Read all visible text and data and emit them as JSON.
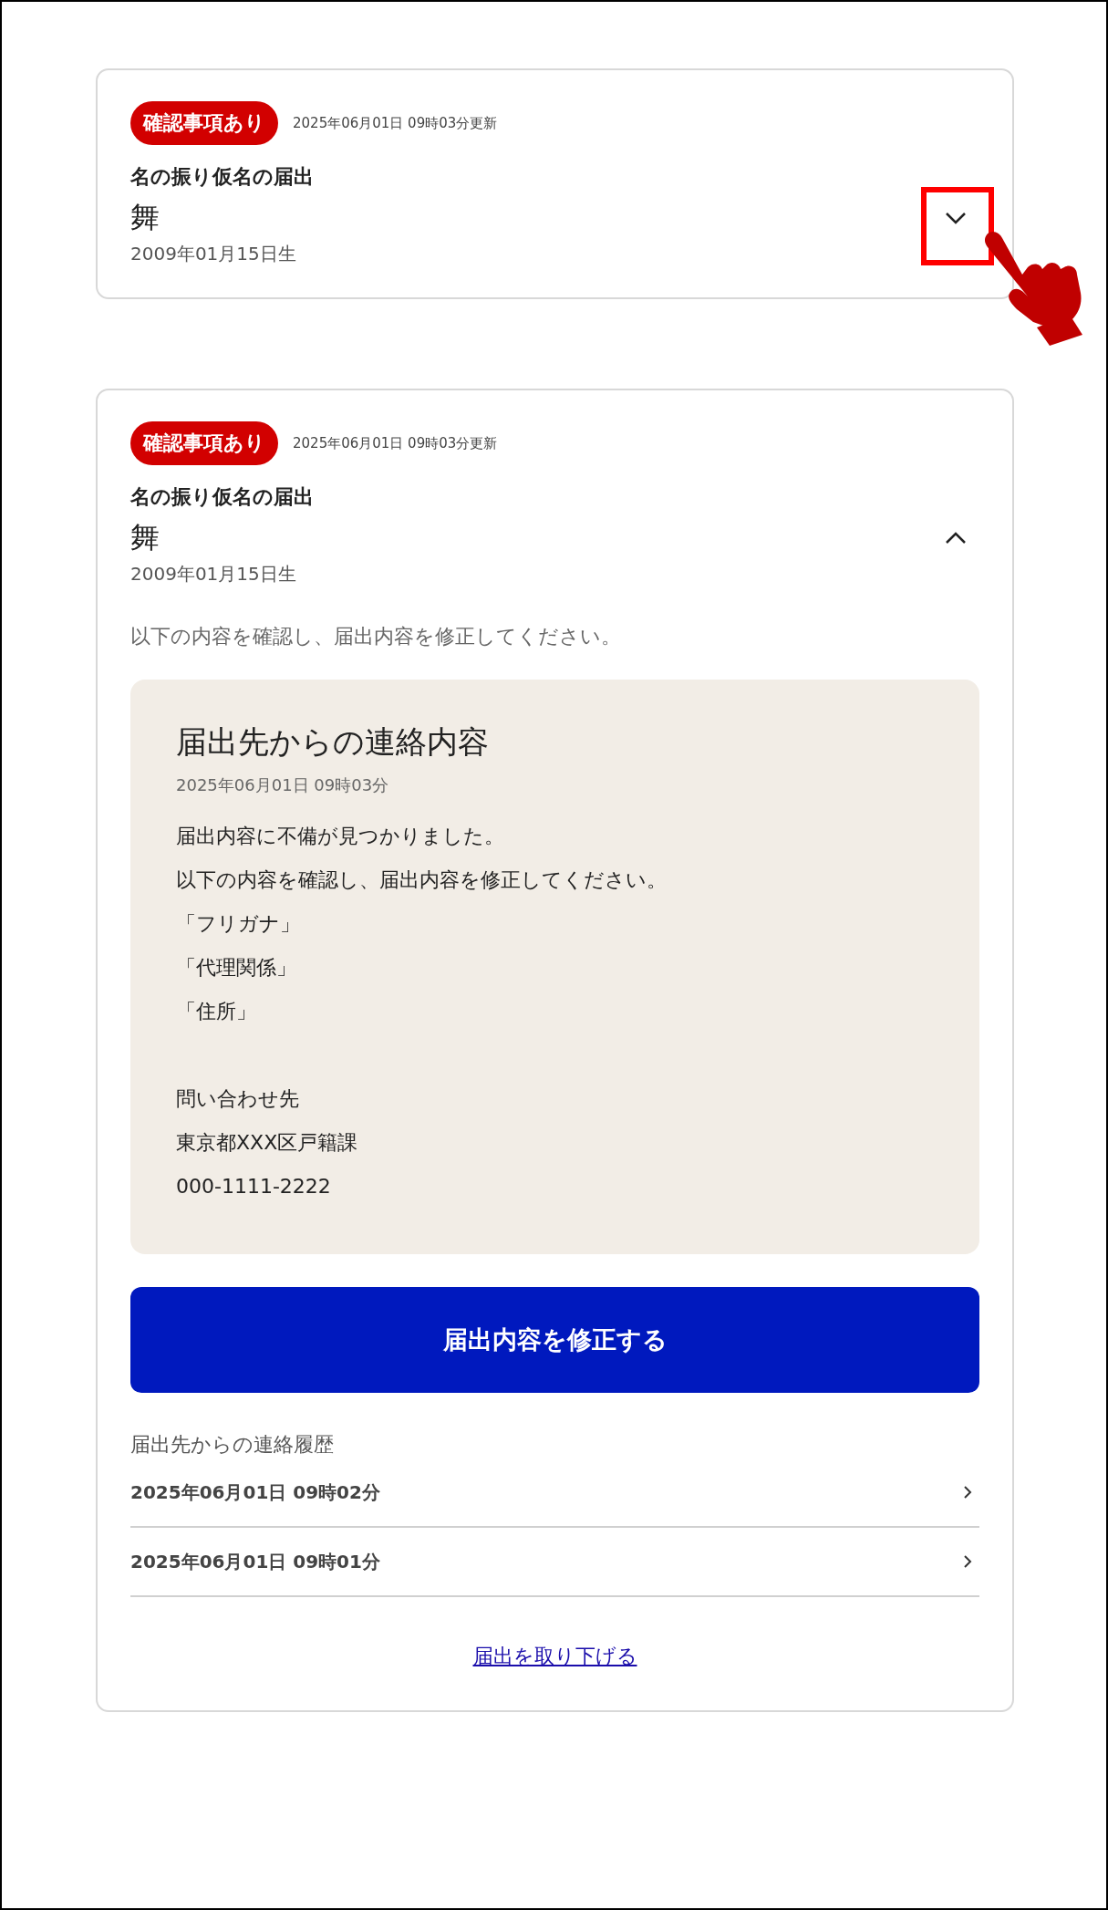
{
  "cards": [
    {
      "badge": "確認事項あり",
      "updated": "2025年06月01日 09時03分更新",
      "title": "名の振り仮名の届出",
      "name": "舞",
      "birth": "2009年01月15日生",
      "expanded": false,
      "pointer_annotation": true
    },
    {
      "badge": "確認事項あり",
      "updated": "2025年06月01日 09時03分更新",
      "title": "名の振り仮名の届出",
      "name": "舞",
      "birth": "2009年01月15日生",
      "expanded": true,
      "pointer_annotation": false,
      "intro": "以下の内容を確認し、届出内容を修正してください。",
      "contact": {
        "heading": "届出先からの連絡内容",
        "date": "2025年06月01日 09時03分",
        "paragraphs": [
          [
            "届出内容に不備が見つかりました。",
            "以下の内容を確認し、届出内容を修正してください。",
            "「フリガナ」",
            "「代理関係」",
            "「住所」"
          ],
          [
            "問い合わせ先",
            "東京都XXX区戸籍課",
            "000-1111-2222"
          ]
        ]
      },
      "button": "届出内容を修正する",
      "history_heading": "届出先からの連絡履歴",
      "history": [
        {
          "date": "2025年06月01日 09時02分"
        },
        {
          "date": "2025年06月01日 09時01分"
        }
      ],
      "withdraw_link": "届出を取り下げる"
    }
  ]
}
